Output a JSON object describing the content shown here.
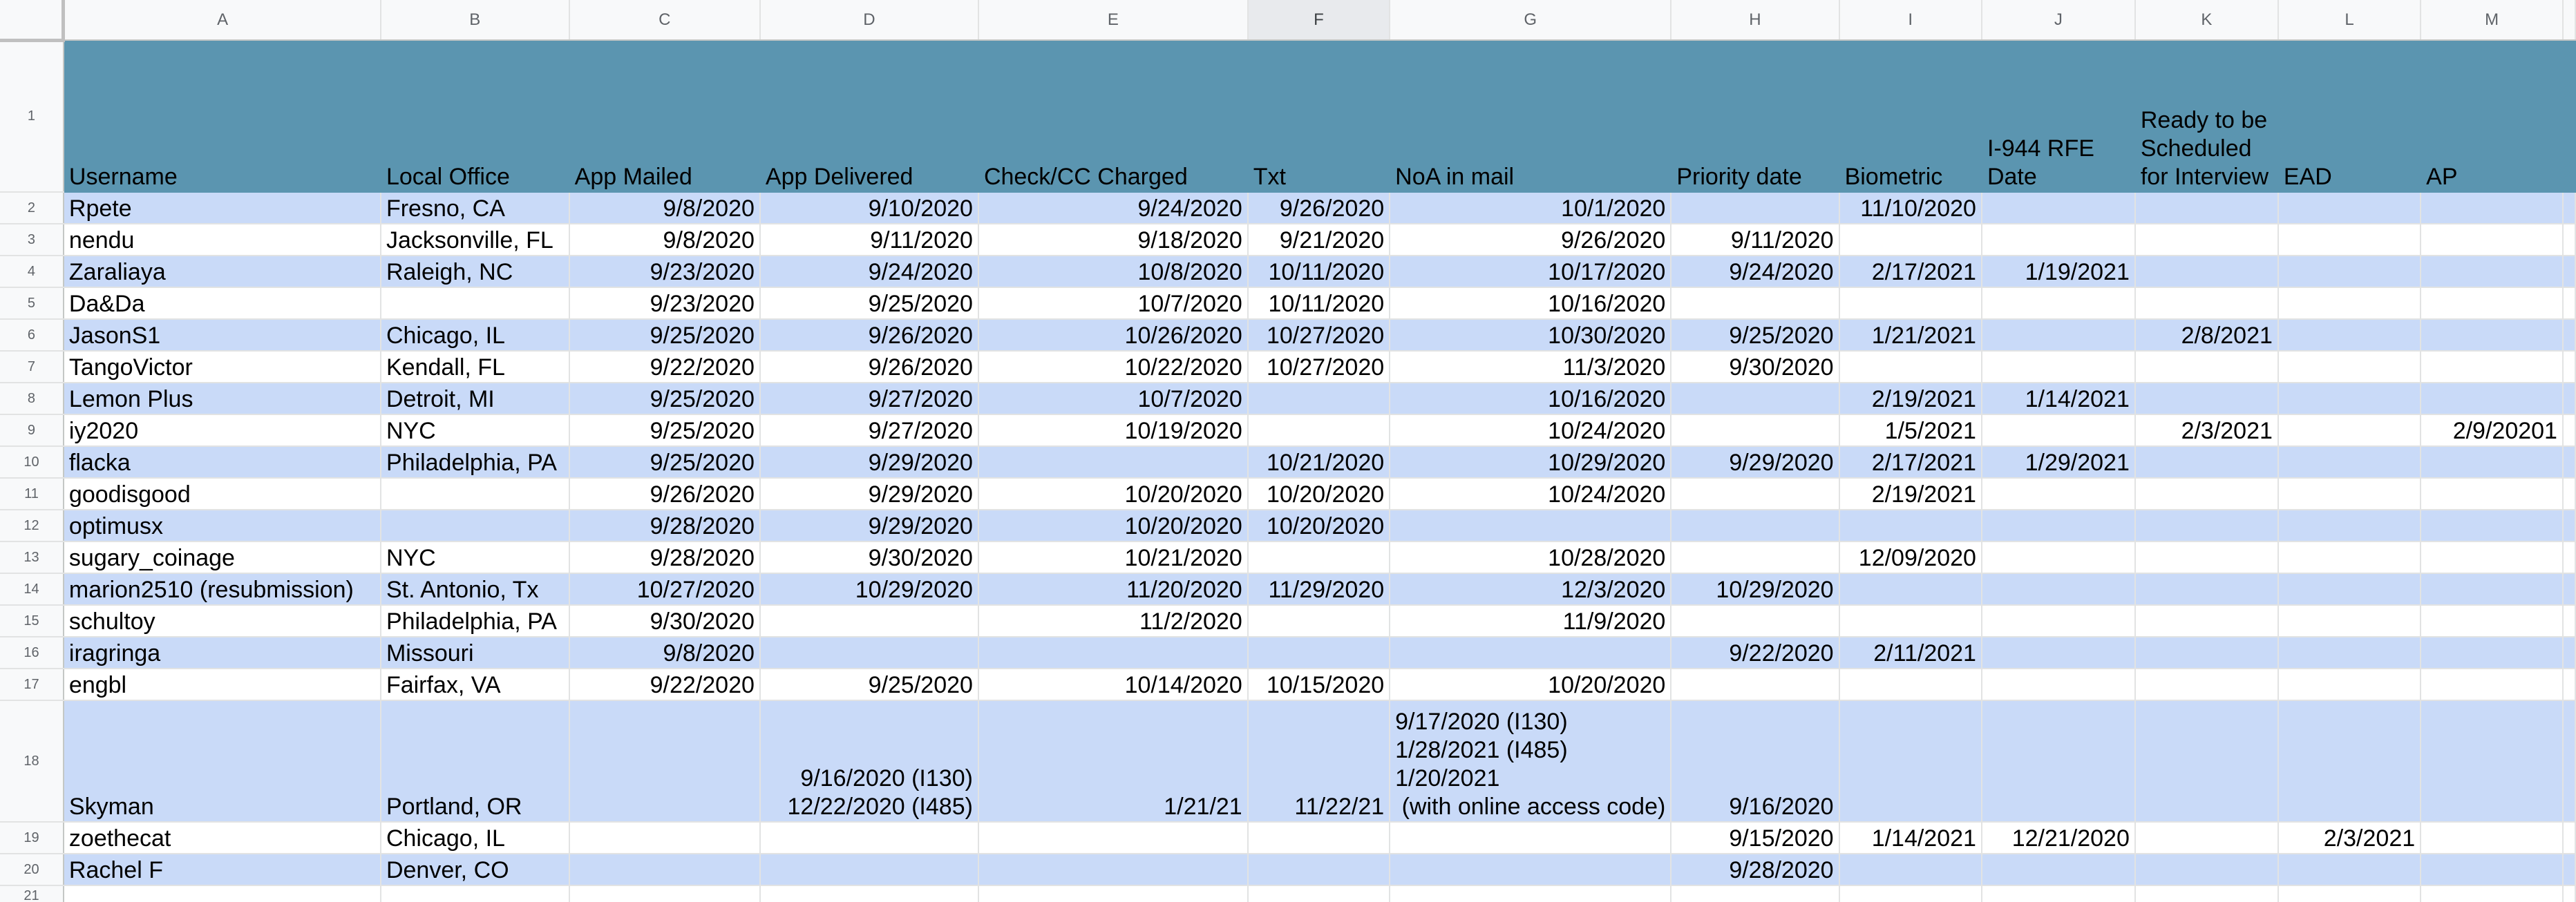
{
  "columns": [
    "A",
    "B",
    "C",
    "D",
    "E",
    "F",
    "G",
    "H",
    "I",
    "J",
    "K",
    "L",
    "M"
  ],
  "selected_column": "F",
  "row_numbers": [
    "1",
    "2",
    "3",
    "4",
    "5",
    "6",
    "7",
    "8",
    "9",
    "10",
    "11",
    "12",
    "13",
    "14",
    "15",
    "16",
    "17",
    "18",
    "19",
    "20",
    "21"
  ],
  "headers": {
    "A": "Username",
    "B": "Local Office",
    "C": "App Mailed",
    "D": "App Delivered",
    "E": "Check/CC Charged",
    "F": "Txt",
    "G": "NoA in mail",
    "H": "Priority date",
    "I": "Biometric",
    "J": "I-944 RFE Date",
    "K": "Ready to be Scheduled for Interview",
    "L": "EAD",
    "M": "AP"
  },
  "rows": [
    {
      "A": "Rpete",
      "B": "Fresno, CA",
      "C": "9/8/2020",
      "D": "9/10/2020",
      "E": "9/24/2020",
      "F": "9/26/2020",
      "G": "10/1/2020",
      "H": "",
      "I": "11/10/2020",
      "J": "",
      "K": "",
      "L": "",
      "M": ""
    },
    {
      "A": "nendu",
      "B": "Jacksonville, FL",
      "C": "9/8/2020",
      "D": "9/11/2020",
      "E": "9/18/2020",
      "F": "9/21/2020",
      "G": "9/26/2020",
      "H": "9/11/2020",
      "I": "",
      "J": "",
      "K": "",
      "L": "",
      "M": ""
    },
    {
      "A": "Zaraliaya",
      "B": "Raleigh, NC",
      "C": "9/23/2020",
      "D": "9/24/2020",
      "E": "10/8/2020",
      "F": "10/11/2020",
      "G": "10/17/2020",
      "H": "9/24/2020",
      "I": "2/17/2021",
      "J": "1/19/2021",
      "K": "",
      "L": "",
      "M": ""
    },
    {
      "A": "Da&Da",
      "B": "",
      "C": "9/23/2020",
      "D": "9/25/2020",
      "E": "10/7/2020",
      "F": "10/11/2020",
      "G": "10/16/2020",
      "H": "",
      "I": "",
      "J": "",
      "K": "",
      "L": "",
      "M": ""
    },
    {
      "A": "JasonS1",
      "B": "Chicago, IL",
      "C": "9/25/2020",
      "D": "9/26/2020",
      "E": "10/26/2020",
      "F": "10/27/2020",
      "G": "10/30/2020",
      "H": "9/25/2020",
      "I": "1/21/2021",
      "J": "",
      "K": "2/8/2021",
      "L": "",
      "M": ""
    },
    {
      "A": "TangoVictor",
      "B": "Kendall, FL",
      "C": "9/22/2020",
      "D": "9/26/2020",
      "E": "10/22/2020",
      "F": "10/27/2020",
      "G": "11/3/2020",
      "H": "9/30/2020",
      "I": "",
      "J": "",
      "K": "",
      "L": "",
      "M": ""
    },
    {
      "A": "Lemon Plus",
      "B": "Detroit, MI",
      "C": "9/25/2020",
      "D": "9/27/2020",
      "E": "10/7/2020",
      "F": "",
      "G": "10/16/2020",
      "H": "",
      "I": "2/19/2021",
      "J": "1/14/2021",
      "K": "",
      "L": "",
      "M": ""
    },
    {
      "A": "iy2020",
      "B": "NYC",
      "C": "9/25/2020",
      "D": "9/27/2020",
      "E": "10/19/2020",
      "F": "",
      "G": "10/24/2020",
      "H": "",
      "I": "1/5/2021",
      "J": "",
      "K": "2/3/2021",
      "L": "",
      "M": "2/9/20201"
    },
    {
      "A": "flacka",
      "B": "Philadelphia, PA",
      "C": "9/25/2020",
      "D": "9/29/2020",
      "E": "",
      "F": "10/21/2020",
      "G": "10/29/2020",
      "H": "9/29/2020",
      "I": "2/17/2021",
      "J": "1/29/2021",
      "K": "",
      "L": "",
      "M": ""
    },
    {
      "A": "goodisgood",
      "B": "",
      "C": "9/26/2020",
      "D": "9/29/2020",
      "E": "10/20/2020",
      "F": "10/20/2020",
      "G": "10/24/2020",
      "H": "",
      "I": "2/19/2021",
      "J": "",
      "K": "",
      "L": "",
      "M": ""
    },
    {
      "A": "optimusx",
      "B": "",
      "C": "9/28/2020",
      "D": "9/29/2020",
      "E": "10/20/2020",
      "F": "10/20/2020",
      "G": "",
      "H": "",
      "I": "",
      "J": "",
      "K": "",
      "L": "",
      "M": ""
    },
    {
      "A": "sugary_coinage",
      "B": "NYC",
      "C": "9/28/2020",
      "D": "9/30/2020",
      "E": "10/21/2020",
      "F": "",
      "G": "10/28/2020",
      "H": "",
      "I": "12/09/2020",
      "J": "",
      "K": "",
      "L": "",
      "M": ""
    },
    {
      "A": "marion2510 (resubmission)",
      "B": "St. Antonio, Tx",
      "C": "10/27/2020",
      "D": "10/29/2020",
      "E": "11/20/2020",
      "F": "11/29/2020",
      "G": "12/3/2020",
      "H": "10/29/2020",
      "I": "",
      "J": "",
      "K": "",
      "L": "",
      "M": ""
    },
    {
      "A": "schultoy",
      "B": "Philadelphia, PA",
      "C": "9/30/2020",
      "D": "",
      "E": "11/2/2020",
      "F": "",
      "G": "11/9/2020",
      "H": "",
      "I": "",
      "J": "",
      "K": "",
      "L": "",
      "M": ""
    },
    {
      "A": "iragringa",
      "B": "Missouri",
      "C": "9/8/2020",
      "D": "",
      "E": "",
      "F": "",
      "G": "",
      "H": "9/22/2020",
      "I": "2/11/2021",
      "J": "",
      "K": "",
      "L": "",
      "M": ""
    },
    {
      "A": "engbl",
      "B": "Fairfax, VA",
      "C": "9/22/2020",
      "D": "9/25/2020",
      "E": "10/14/2020",
      "F": "10/15/2020",
      "G": "10/20/2020",
      "H": "",
      "I": "",
      "J": "",
      "K": "",
      "L": "",
      "M": ""
    },
    {
      "A": "Skyman",
      "B": "Portland, OR",
      "C": "",
      "D": "9/16/2020 (I130)\n12/22/2020 (I485)",
      "E": "1/21/21",
      "F": "11/22/21",
      "G": "9/17/2020 (I130)\n1/28/2021 (I485)\n1/20/2021\n (with online access code)",
      "H": "9/16/2020",
      "I": "",
      "J": "",
      "K": "",
      "L": "",
      "M": ""
    },
    {
      "A": "zoethecat",
      "B": "Chicago, IL",
      "C": "",
      "D": "",
      "E": "",
      "F": "",
      "G": "",
      "H": "9/15/2020",
      "I": "1/14/2021",
      "J": "12/21/2020",
      "K": "",
      "L": "2/3/2021",
      "M": ""
    },
    {
      "A": "Rachel F",
      "B": "Denver, CO",
      "C": "",
      "D": "",
      "E": "",
      "F": "",
      "G": "",
      "H": "9/28/2020",
      "I": "",
      "J": "",
      "K": "",
      "L": "",
      "M": ""
    },
    {
      "A": "",
      "B": "",
      "C": "",
      "D": "",
      "E": "",
      "F": "",
      "G": "",
      "H": "",
      "I": "",
      "J": "",
      "K": "",
      "L": "",
      "M": ""
    }
  ],
  "colors": {
    "header_fill": "#5b95b0",
    "band_fill": "#c9daf8",
    "white_fill": "#ffffff",
    "gridline": "#e2e3e3",
    "heading_bg": "#f8f9fa"
  }
}
